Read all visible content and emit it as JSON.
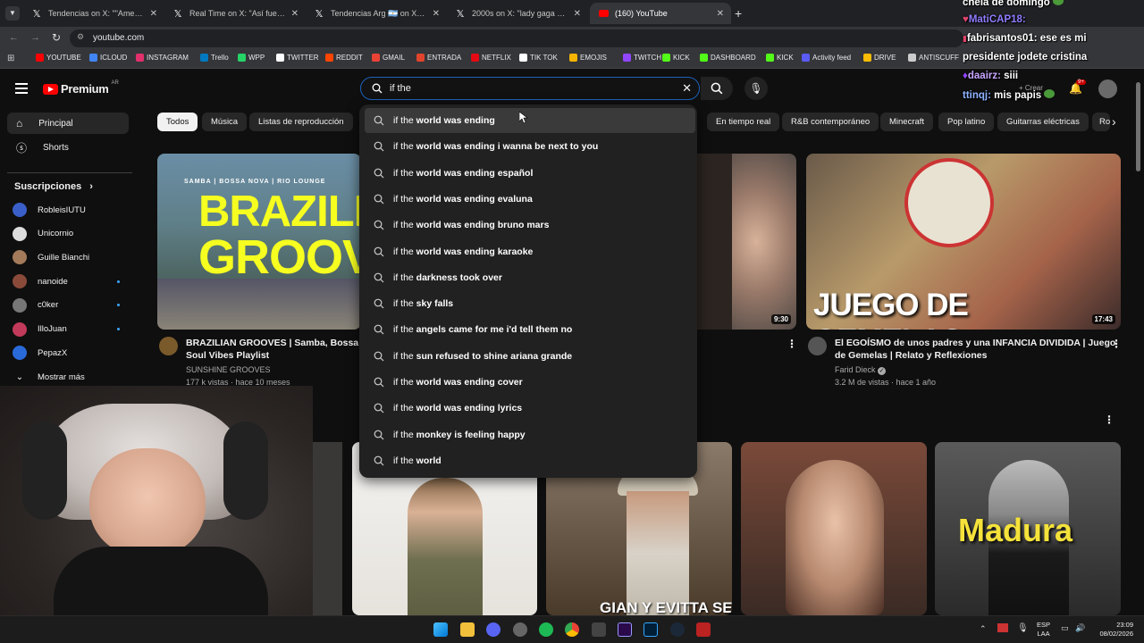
{
  "browser": {
    "tabs": [
      {
        "label": "Tendencias on X: \"\"American Id",
        "icon": "x-logo-icon"
      },
      {
        "label": "Real Time on X: \"Así fue el show",
        "icon": "x-logo-icon"
      },
      {
        "label": "Tendencias Arg 🇦🇷 on X: \"\"GTA",
        "icon": "x-logo-icon"
      },
      {
        "label": "2000s on X: \"lady gaga perform",
        "icon": "x-logo-icon"
      },
      {
        "label": "(160) YouTube",
        "icon": "youtube-logo-icon",
        "active": true
      }
    ],
    "url": "youtube.com",
    "bookmarks": [
      {
        "label": "YOUTUBE",
        "color": "#ff0000"
      },
      {
        "label": "ICLOUD",
        "color": "#4285f4"
      },
      {
        "label": "INSTAGRAM",
        "color": "#e1306c"
      },
      {
        "label": "Trello",
        "color": "#0079bf"
      },
      {
        "label": "WPP",
        "color": "#25d366"
      },
      {
        "label": "TWITTER",
        "color": "#ffffff"
      },
      {
        "label": "REDDIT",
        "color": "#ff4500"
      },
      {
        "label": "GMAIL",
        "color": "#ea4335"
      },
      {
        "label": "ENTRADA",
        "color": "#e0442c"
      },
      {
        "label": "NETFLIX",
        "color": "#e50914"
      },
      {
        "label": "TIK TOK",
        "color": "#ffffff"
      },
      {
        "label": "EMOJIS",
        "color": "#f5b400"
      },
      {
        "label": "TWITCH",
        "color": "#9146ff"
      },
      {
        "label": "KICK",
        "color": "#53fc18"
      },
      {
        "label": "DASHBOARD",
        "color": "#53fc18"
      },
      {
        "label": "KICK",
        "color": "#53fc18"
      },
      {
        "label": "Activity feed",
        "color": "#5b5bf7"
      },
      {
        "label": "DRIVE",
        "color": "#fbbc04"
      },
      {
        "label": "ANTISCUFF",
        "color": "#cccccc"
      }
    ]
  },
  "youtube": {
    "logo_text": "Premium",
    "logo_region": "AR",
    "search_value": "if the",
    "create_label": "Crear",
    "notif_count": "9+",
    "sidebar": {
      "main": [
        {
          "label": "Principal"
        },
        {
          "label": "Shorts"
        }
      ],
      "subs_title": "Suscripciones",
      "subs": [
        {
          "label": "RobleisIUTU",
          "color": "#3a5fc8"
        },
        {
          "label": "Unicornio",
          "color": "#dddddd"
        },
        {
          "label": "Guille Bianchi",
          "color": "#a37a5a"
        },
        {
          "label": "nanoide",
          "color": "#8a4a3a"
        },
        {
          "label": "c0ker",
          "color": "#777777"
        },
        {
          "label": "IlloJuan",
          "color": "#c23a5a"
        },
        {
          "label": "PepazX",
          "color": "#2a6ad8"
        }
      ],
      "more": "Mostrar más"
    },
    "chips": [
      "Todos",
      "Música",
      "Listas de reproducción",
      "En tiempo real",
      "R&B contemporáneo",
      "Minecraft",
      "Pop latino",
      "Guitarras eléctricas",
      "Ro"
    ],
    "suggestions": [
      {
        "base": "if the",
        "rest": " world was ending"
      },
      {
        "base": "if the",
        "rest": " world was ending i wanna be next to you"
      },
      {
        "base": "if the",
        "rest": " world was ending español"
      },
      {
        "base": "if the",
        "rest": " world was ending evaluna"
      },
      {
        "base": "if the",
        "rest": " world was ending bruno mars"
      },
      {
        "base": "if the",
        "rest": " world was ending karaoke"
      },
      {
        "base": "if the",
        "rest": " darkness took over"
      },
      {
        "base": "if the",
        "rest": " sky falls"
      },
      {
        "base": "if the",
        "rest": " angels came for me i'd tell them no"
      },
      {
        "base": "if the",
        "rest": " sun refused to shine ariana grande"
      },
      {
        "base": "if the",
        "rest": " world was ending cover"
      },
      {
        "base": "if the",
        "rest": " world was ending lyrics"
      },
      {
        "base": "if the",
        "rest": " monkey is feeling happy"
      },
      {
        "base": "if the",
        "rest": " world"
      }
    ],
    "videos": [
      {
        "thumb_text_1": "BRAZILI",
        "thumb_text_2": "GROOV",
        "thumb_top": "SAMBA | BOSSA NOVA | RIO LOUNGE",
        "title_1": "BRAZILIAN GROOVES | Samba, Bossa No",
        "title_2": "Soul Vibes Playlist",
        "channel": "SUNSHINE GROOVES",
        "meta": "177 k vistas · hace 10 meses"
      },
      {
        "duration": "9:30"
      },
      {
        "thumb_text": "JUEGO DE GEMELAS",
        "duration": "17:43",
        "title_1": "El EGOÍSMO de unos padres y una INFANCIA DIVIDIDA | Juego",
        "title_2": "de Gemelas | Relato y Reflexiones",
        "channel": "Farid Dieck",
        "meta": "3.2 M de vistas · hace 1 año"
      },
      {
        "thumb_text": "GIAN Y EVITTA SE"
      },
      {
        "thumb_text": "Madura"
      }
    ]
  },
  "chat": [
    {
      "user": "",
      "text": "chela de domingo",
      "color": "#ffffff"
    },
    {
      "user": "MatiCAP18:",
      "text": "",
      "color": "#8e7dff"
    },
    {
      "user": "fabrisantos01:",
      "text": " ese es mi",
      "color": "#ffffff"
    },
    {
      "user": "",
      "text": "presidente jodete cristina",
      "color": "#ffffff"
    },
    {
      "user": "daairz:",
      "text": " siii",
      "color": "#c9a6ff"
    },
    {
      "user": "ttinqj:",
      "text": " mis papis",
      "color": "#8eb4ff"
    }
  ],
  "taskbar": {
    "lang_1": "ESP",
    "lang_2": "LAA",
    "time": "23:09",
    "date": "08/02/2026"
  }
}
